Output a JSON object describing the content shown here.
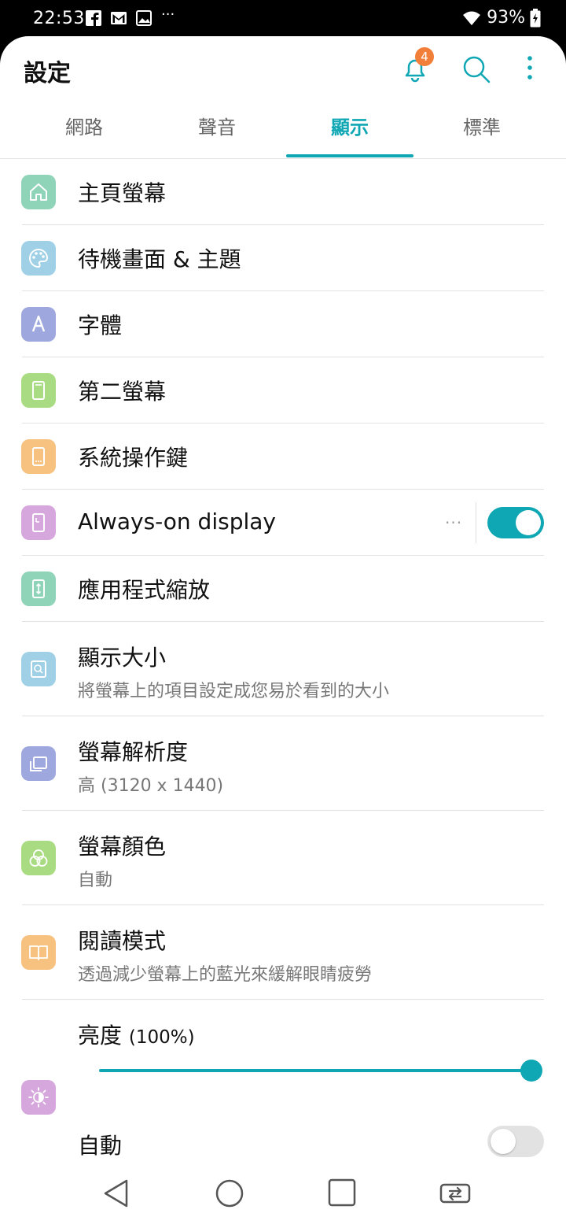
{
  "status_bar": {
    "time": "22:53",
    "notification_icons": [
      "facebook-icon",
      "gmail-icon",
      "gallery-icon"
    ],
    "overflow": "···",
    "battery": "93%",
    "wifi": "wifi-icon"
  },
  "header": {
    "title": "設定",
    "notification_count": "4"
  },
  "tabs": [
    {
      "label": "網路",
      "active": false
    },
    {
      "label": "聲音",
      "active": false
    },
    {
      "label": "顯示",
      "active": true
    },
    {
      "label": "標準",
      "active": false
    }
  ],
  "items": [
    {
      "label": "主頁螢幕",
      "icon": "home-icon",
      "color": "#8fd4b8"
    },
    {
      "label": "待機畫面 & 主題",
      "icon": "palette-icon",
      "color": "#9fd0e6"
    },
    {
      "label": "字體",
      "icon": "font-icon",
      "color": "#9ea7de"
    },
    {
      "label": "第二螢幕",
      "icon": "phone-outline-icon",
      "color": "#a9dc82"
    },
    {
      "label": "系統操作鍵",
      "icon": "nav-keys-icon",
      "color": "#f7c27f"
    },
    {
      "label": "Always-on display",
      "icon": "aod-icon",
      "color": "#d6a7dc",
      "more": "···",
      "toggle_on": true
    },
    {
      "label": "應用程式縮放",
      "icon": "app-scaling-icon",
      "color": "#8fd4b8"
    },
    {
      "label": "顯示大小",
      "sub": "將螢幕上的項目設定成您易於看到的大小",
      "icon": "display-size-icon",
      "color": "#9fd0e6"
    },
    {
      "label": "螢幕解析度",
      "sub": "高 (3120 x 1440)",
      "icon": "resolution-icon",
      "color": "#9ea7de"
    },
    {
      "label": "螢幕顏色",
      "sub": "自動",
      "icon": "color-circles-icon",
      "color": "#a9dc82"
    },
    {
      "label": "閱讀模式",
      "sub": "透過減少螢幕上的藍光來緩解眼睛疲勞",
      "icon": "book-icon",
      "color": "#f7c27f"
    }
  ],
  "brightness": {
    "label": "亮度",
    "value_text": "(100%)",
    "level": 1.0,
    "auto_label": "自動",
    "auto_on": false,
    "icon": "brightness-icon",
    "color": "#d6a7dc"
  },
  "colors": {
    "accent": "#10a7b4",
    "badge": "#f17f3a"
  },
  "navbar": [
    "back-icon",
    "home-circle-icon",
    "recents-icon",
    "dual-screen-icon"
  ]
}
